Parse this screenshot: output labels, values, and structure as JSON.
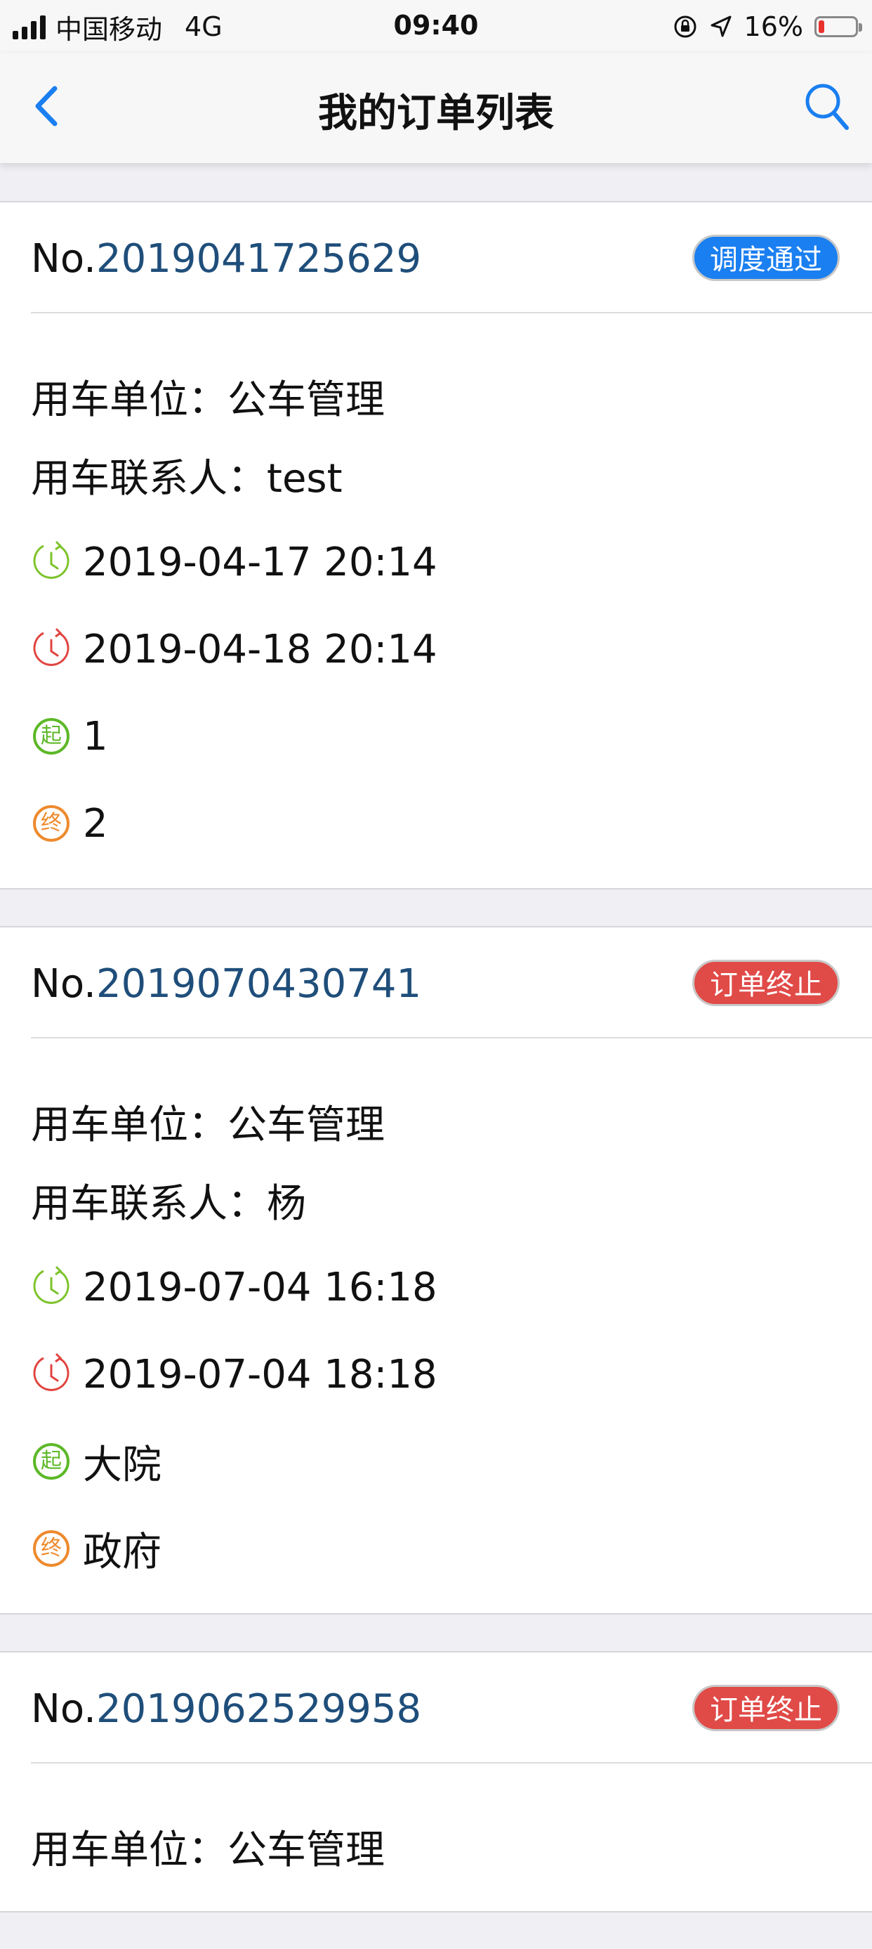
{
  "status_bar": {
    "carrier": "中国移动",
    "network": "4G",
    "time": "09:40",
    "battery": "16%",
    "battery_level": 0.16
  },
  "nav": {
    "title": "我的订单列表"
  },
  "labels": {
    "order_prefix": "No.",
    "unit_label": "用车单位：",
    "contact_label": "用车联系人：",
    "start_glyph": "起",
    "end_glyph": "终"
  },
  "colors": {
    "badge_approved": "#1a7ff0",
    "badge_terminated": "#e04a47",
    "start_time_icon": "#7cc32a",
    "end_time_icon": "#e0443f",
    "start_place_icon": "#5db828",
    "end_place_icon": "#ee8a2d",
    "order_number": "#1f4e7a",
    "nav_icons": "#1a7ff0"
  },
  "orders": [
    {
      "number": "2019041725629",
      "status": "调度通过",
      "status_type": "approved",
      "unit": "公车管理",
      "contact": "test",
      "start_time": "2019-04-17 20:14",
      "end_time": "2019-04-18 20:14",
      "start_place": "1",
      "end_place": "2"
    },
    {
      "number": "2019070430741",
      "status": "订单终止",
      "status_type": "terminated",
      "unit": "公车管理",
      "contact": "杨",
      "start_time": "2019-07-04 16:18",
      "end_time": "2019-07-04 18:18",
      "start_place": "大院",
      "end_place": "政府"
    },
    {
      "number": "2019062529958",
      "status": "订单终止",
      "status_type": "terminated",
      "unit": "公车管理"
    }
  ]
}
